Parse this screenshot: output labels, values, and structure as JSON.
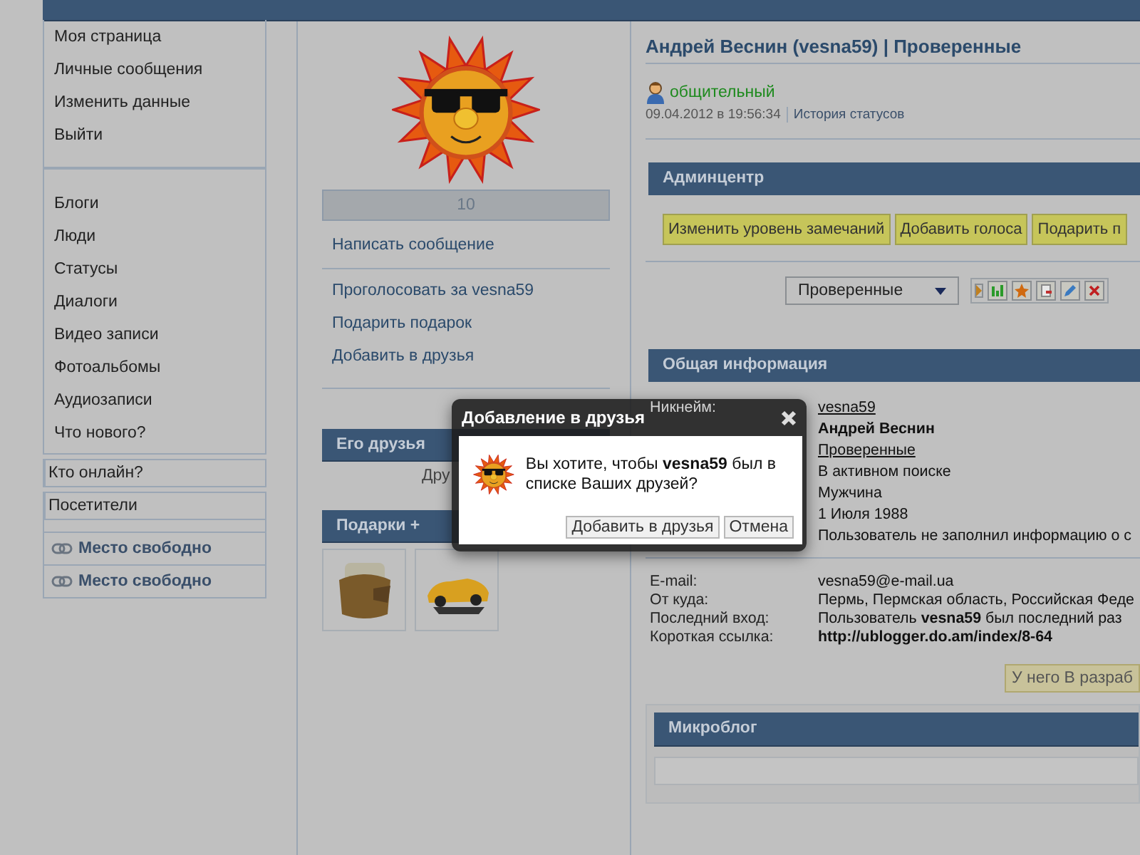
{
  "sidebar": {
    "menu": [
      "Моя страница",
      "Личные сообщения",
      "Изменить данные",
      "Выйти"
    ],
    "sections": [
      "Блоги",
      "Люди",
      "Статусы",
      "Диалоги",
      "Видео записи",
      "Фотоальбомы",
      "Аудиозаписи",
      "Что нового?"
    ],
    "boxes": [
      "Кто онлайн?",
      "Посетители"
    ],
    "free_slots": [
      "Место свободно",
      "Место свободно"
    ]
  },
  "profile_column": {
    "counter": "10",
    "actions": [
      "Написать сообщение"
    ],
    "actions_2": [
      "Проголосовать за vesna59",
      "Подарить подарок",
      "Добавить в друзья"
    ],
    "friends": {
      "title": "Его друзья",
      "text": "Дру"
    },
    "gifts": {
      "title": "Подарки +",
      "items": [
        {
          "kind": "wallet"
        },
        {
          "kind": "car"
        }
      ]
    }
  },
  "profile": {
    "title": "Андрей Веснин (vesna59) | Проверенные",
    "status": "общительный",
    "status_date": "09.04.2012 в 19:56:34",
    "status_history": "История статусов",
    "admin": {
      "title": "Админцентр",
      "buttons": [
        "Изменить уровень замечаний",
        "Добавить голоса",
        "Подарить п"
      ],
      "group_select": "Проверенные"
    },
    "info": {
      "title": "Общая информация",
      "rows": [
        {
          "label": "Никнейм:",
          "value": "vesna59",
          "kind": "link"
        },
        {
          "value": "Андрей Веснин",
          "kind": "bold"
        },
        {
          "value": "Проверенные",
          "kind": "link"
        },
        {
          "value": "В активном поиске",
          "kind": "text"
        },
        {
          "value": "Мужчина",
          "kind": "text"
        },
        {
          "value": "1 Июля 1988",
          "kind": "text"
        },
        {
          "value": "Пользователь не заполнил информацию о с",
          "kind": "text"
        }
      ]
    },
    "contacts": [
      {
        "label": "E-mail:",
        "value": "vesna59@e-mail.ua",
        "kind": "text"
      },
      {
        "label": "От куда:",
        "value": "Пермь, Пермская область, Российская Феде",
        "kind": "text"
      },
      {
        "label": "Последний вход:",
        "value": "Пользователь **vesna59** был последний раз",
        "kind": "text"
      },
      {
        "label": "Короткая ссылка:",
        "value": "http://ublogger.do.am/index/8-64",
        "kind": "bold"
      }
    ],
    "dev_button": "У него В разраб",
    "microblog": {
      "title": "Микроблог"
    }
  },
  "dialog": {
    "title": "Добавление в друзья",
    "message": "Вы хотите, чтобы **vesna59** был в списке Ваших друзей?",
    "buttons": [
      "Добавить в друзья",
      "Отмена"
    ]
  }
}
